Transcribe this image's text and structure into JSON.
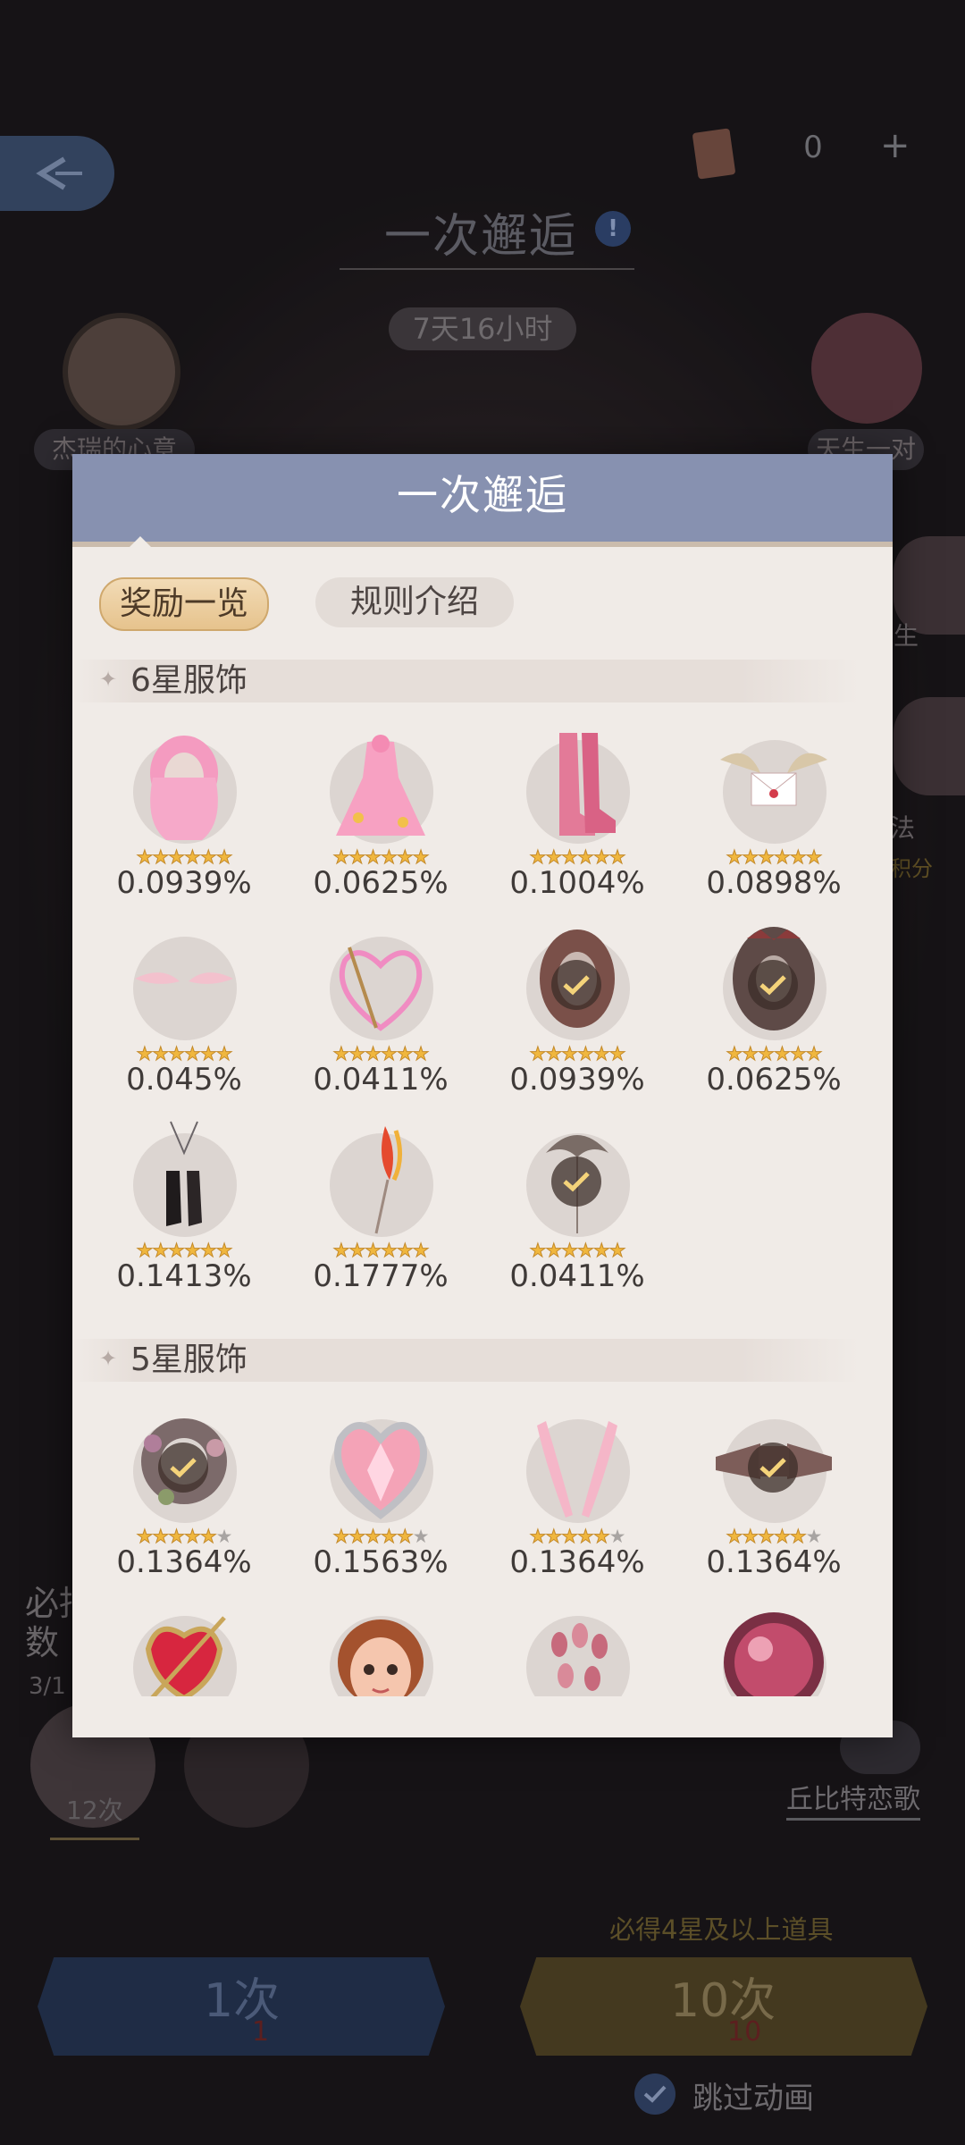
{
  "background": {
    "title": "一次邂逅",
    "timer": "7天16小时",
    "currency_count": "0",
    "plus": "+",
    "roulette_label": "杰瑞的心意",
    "gift_label": "天生一对",
    "side_label_1": "生",
    "side_label_2": "法",
    "side_sub_2": "积分",
    "guarantee_text_line1": "必抽",
    "guarantee_text_line2": "数",
    "guarantee_progress": "3/1",
    "guarantee_count": "12次",
    "cupid_song": "丘比特恋歌",
    "banner_note": "必得4星及以上道具",
    "draw_once_label": "1次",
    "draw_once_cost": "1",
    "draw_ten_label": "10次",
    "draw_ten_cost": "10",
    "skip_animation": "跳过动画"
  },
  "modal": {
    "title": "一次邂逅",
    "tabs": [
      {
        "label": "奖励一览",
        "active": true
      },
      {
        "label": "规则介绍",
        "active": false
      }
    ],
    "sections": [
      {
        "label": "6星服饰",
        "items": [
          {
            "art": "pink-hair-icon",
            "stars": 6,
            "max_stars": 6,
            "pct": "0.0939%",
            "owned": false
          },
          {
            "art": "pink-dress-icon",
            "stars": 6,
            "max_stars": 6,
            "pct": "0.0625%",
            "owned": false
          },
          {
            "art": "pink-boots-icon",
            "stars": 6,
            "max_stars": 6,
            "pct": "0.1004%",
            "owned": false
          },
          {
            "art": "winged-letter-icon",
            "stars": 6,
            "max_stars": 6,
            "pct": "0.0898%",
            "owned": false
          },
          {
            "art": "pink-wings-icon",
            "stars": 6,
            "max_stars": 6,
            "pct": "0.045%",
            "owned": false
          },
          {
            "art": "heart-bow-icon",
            "stars": 6,
            "max_stars": 6,
            "pct": "0.0411%",
            "owned": false
          },
          {
            "art": "brown-hair-icon",
            "stars": 6,
            "max_stars": 6,
            "pct": "0.0939%",
            "owned": true
          },
          {
            "art": "dark-hair-icon",
            "stars": 6,
            "max_stars": 6,
            "pct": "0.0625%",
            "owned": true
          },
          {
            "art": "black-boots-icon",
            "stars": 6,
            "max_stars": 6,
            "pct": "0.1413%",
            "owned": false
          },
          {
            "art": "feather-arrow-icon",
            "stars": 6,
            "max_stars": 6,
            "pct": "0.1777%",
            "owned": false
          },
          {
            "art": "hair-ornament-icon",
            "stars": 6,
            "max_stars": 6,
            "pct": "0.0411%",
            "owned": true
          }
        ]
      },
      {
        "label": "5星服饰",
        "items": [
          {
            "art": "flower-wreath-icon",
            "stars": 5,
            "max_stars": 6,
            "pct": "0.1364%",
            "owned": true
          },
          {
            "art": "crystal-heart-icon",
            "stars": 5,
            "max_stars": 6,
            "pct": "0.1563%",
            "owned": false
          },
          {
            "art": "pink-gloves-icon",
            "stars": 5,
            "max_stars": 6,
            "pct": "0.1364%",
            "owned": false
          },
          {
            "art": "ribbon-bow-icon",
            "stars": 5,
            "max_stars": 6,
            "pct": "0.1364%",
            "owned": true
          },
          {
            "art": "ruby-brooch-icon",
            "stars": 5,
            "max_stars": 6,
            "pct": "",
            "owned": false
          },
          {
            "art": "face-icon",
            "stars": 5,
            "max_stars": 6,
            "pct": "",
            "owned": false
          },
          {
            "art": "nails-icon",
            "stars": 5,
            "max_stars": 6,
            "pct": "",
            "owned": false
          },
          {
            "art": "pink-orb-icon",
            "stars": 5,
            "max_stars": 6,
            "pct": "",
            "owned": false
          }
        ]
      }
    ]
  },
  "colors": {
    "header": "#8791b0",
    "panel": "#f0ebe7",
    "tab_active": "#e6c38d",
    "star": "#f0b73e"
  }
}
